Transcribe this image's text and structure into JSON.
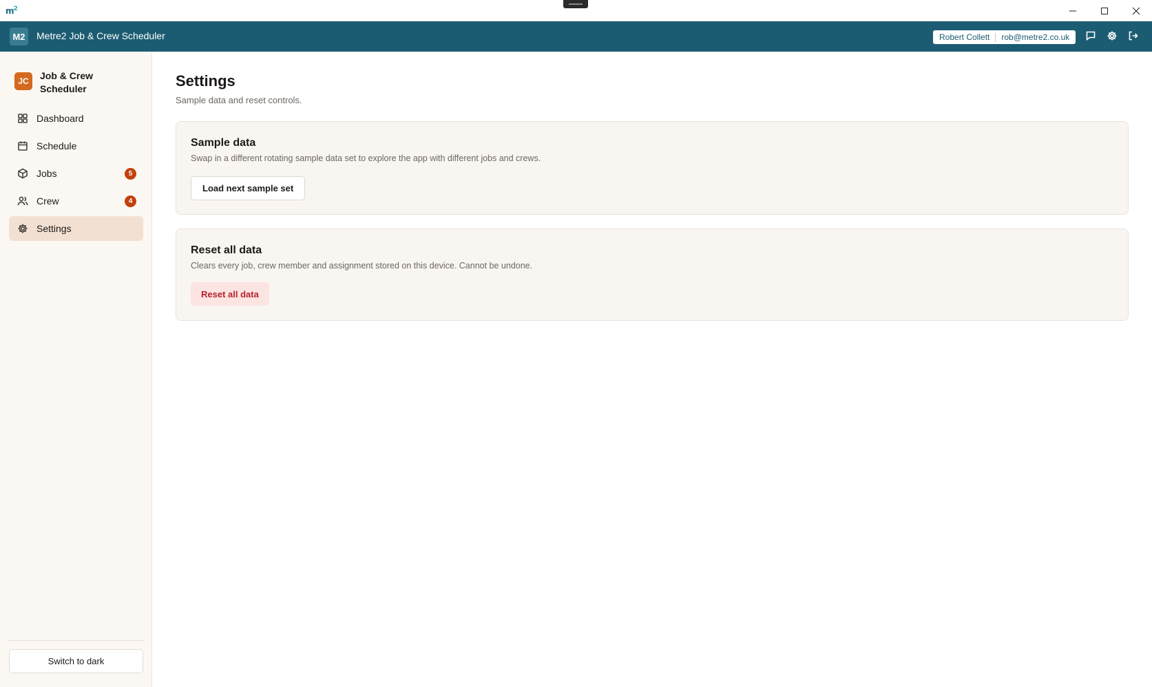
{
  "window": {
    "logo_text": "m",
    "logo_sup": "2"
  },
  "header": {
    "badge": "M2",
    "title": "Metre2 Job & Crew Scheduler",
    "user_name": "Robert Collett",
    "user_email": "rob@metre2.co.uk",
    "icons": [
      "chat-icon",
      "gear-icon",
      "logout-icon"
    ]
  },
  "sidebar": {
    "brand_badge": "JC",
    "brand_name": "Job & Crew Scheduler",
    "items": [
      {
        "label": "Dashboard",
        "icon": "dashboard-icon",
        "count": null,
        "active": false
      },
      {
        "label": "Schedule",
        "icon": "calendar-icon",
        "count": null,
        "active": false
      },
      {
        "label": "Jobs",
        "icon": "box-icon",
        "count": "5",
        "active": false
      },
      {
        "label": "Crew",
        "icon": "users-icon",
        "count": "4",
        "active": false
      },
      {
        "label": "Settings",
        "icon": "gear-icon",
        "count": null,
        "active": true
      }
    ],
    "theme_button": "Switch to dark"
  },
  "main": {
    "title": "Settings",
    "subtitle": "Sample data and reset controls.",
    "sample_card": {
      "title": "Sample data",
      "description": "Swap in a different rotating sample data set to explore the app with different jobs and crews.",
      "button": "Load next sample set"
    },
    "reset_card": {
      "title": "Reset all data",
      "description": "Clears every job, crew member and assignment stored on this device. Cannot be undone.",
      "button": "Reset all data"
    }
  },
  "colors": {
    "header_bg": "#1b5c72",
    "brand_accent": "#d46a1f",
    "active_nav_bg": "#f2e1d3",
    "count_badge": "#c2410c",
    "danger_text": "#b4232c",
    "danger_bg": "#fbe4e1"
  }
}
